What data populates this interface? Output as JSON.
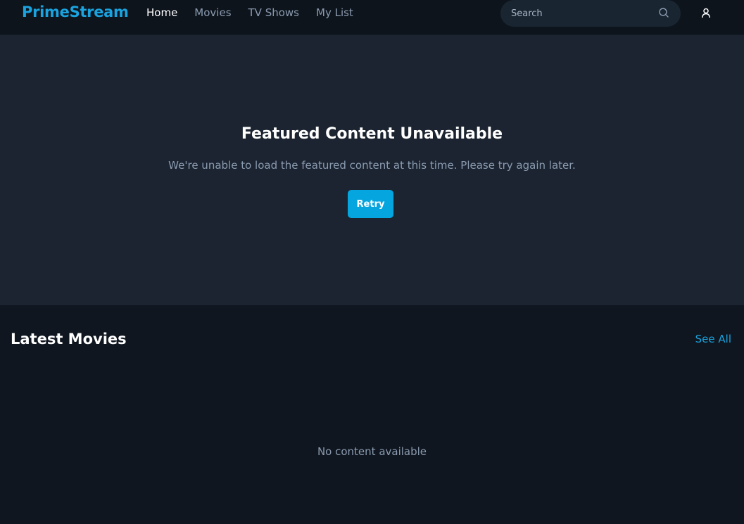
{
  "header": {
    "logo": "PrimeStream",
    "nav": [
      {
        "label": "Home",
        "active": true
      },
      {
        "label": "Movies",
        "active": false
      },
      {
        "label": "TV Shows",
        "active": false
      },
      {
        "label": "My List",
        "active": false
      }
    ],
    "search": {
      "placeholder": "Search",
      "value": "",
      "icon": "search-icon"
    },
    "user_icon": "user-icon"
  },
  "hero": {
    "title": "Featured Content Unavailable",
    "message": "We're unable to load the featured content at this time. Please try again later.",
    "retry_label": "Retry"
  },
  "latest": {
    "title": "Latest Movies",
    "see_all_label": "See All",
    "empty_message": "No content available"
  },
  "colors": {
    "accent": "#05a5e0",
    "logo": "#1aa3df",
    "page_background": "#0f161f",
    "hero_background": "#1b2430",
    "muted_text": "#8b9bb0"
  }
}
